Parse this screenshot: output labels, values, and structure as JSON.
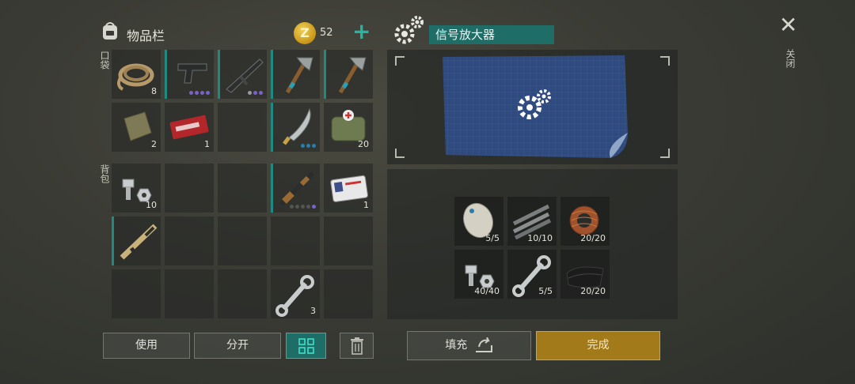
{
  "inventory": {
    "title": "物品栏",
    "currency": {
      "symbol": "Z",
      "amount": "52"
    },
    "add_label": "+",
    "pockets_label": "口袋",
    "backpack_label": "背包"
  },
  "pockets": [
    {
      "item": "rope-icon",
      "qty": "8"
    },
    {
      "item": "pistol-icon",
      "dots": [
        "#7a62c8",
        "#7a62c8",
        "#7a62c8",
        "#7a62c8"
      ]
    },
    {
      "item": "rifle-icon",
      "dots": [
        "#9a9a9a",
        "#7a62c8",
        "#7a62c8"
      ]
    },
    {
      "item": "axe-icon"
    },
    {
      "item": "axe-icon"
    },
    {
      "item": "cloth-icon",
      "qty": "2"
    },
    {
      "item": "coupon-icon",
      "qty": "1"
    },
    {
      "item": ""
    },
    {
      "item": "machete-icon",
      "dots": [
        "#2c7ea8",
        "#2c7ea8",
        "#2c7ea8"
      ]
    },
    {
      "item": "medkit-icon",
      "qty": "20"
    }
  ],
  "backpack": [
    {
      "item": "bolt-nut-icon",
      "qty": "10"
    },
    {
      "item": ""
    },
    {
      "item": ""
    },
    {
      "item": "shotgun-icon",
      "dots": [
        "#555",
        "#555",
        "#555",
        "#555",
        "#7a62c8"
      ]
    },
    {
      "item": "id-card-icon",
      "qty": "1"
    },
    {
      "item": "assault-rifle-icon"
    },
    {
      "item": ""
    },
    {
      "item": ""
    },
    {
      "item": ""
    },
    {
      "item": ""
    },
    {
      "item": ""
    },
    {
      "item": ""
    },
    {
      "item": ""
    },
    {
      "item": "wrench-icon",
      "qty": "3"
    },
    {
      "item": ""
    }
  ],
  "buttons": {
    "use": "使用",
    "split": "分开",
    "fill": "填充",
    "done": "完成"
  },
  "craft": {
    "item_name": "信号放大器",
    "close_label": "关闭",
    "requirements": [
      {
        "item": "dish-icon",
        "count": "5/5"
      },
      {
        "item": "rebar-icon",
        "count": "10/10"
      },
      {
        "item": "copper-wire-icon",
        "count": "20/20"
      },
      {
        "item": "bolt-nut-icon",
        "count": "40/40"
      },
      {
        "item": "wrench-icon",
        "count": "5/5"
      },
      {
        "item": "leather-icon",
        "count": "20/20"
      }
    ]
  },
  "colors": {
    "accent": "#1f6d67",
    "done": "#a27a1a",
    "coin": "#d9a52a"
  }
}
